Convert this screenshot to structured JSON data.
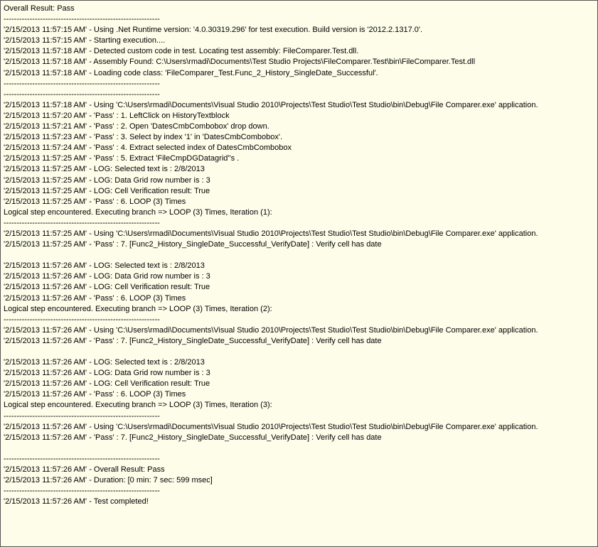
{
  "log": {
    "lines": [
      "Overall Result: Pass",
      "------------------------------------------------------------",
      "'2/15/2013 11:57:15 AM' - Using .Net Runtime version: '4.0.30319.296' for test execution. Build version is '2012.2.1317.0'.",
      "'2/15/2013 11:57:15 AM' - Starting execution....",
      "'2/15/2013 11:57:18 AM' - Detected custom code in test. Locating test assembly: FileComparer.Test.dll.",
      "'2/15/2013 11:57:18 AM' - Assembly Found: C:\\Users\\rmadi\\Documents\\Test Studio Projects\\FileComparer.Test\\bin\\FileComparer.Test.dll",
      "'2/15/2013 11:57:18 AM' - Loading code class: 'FileComparer_Test.Func_2_History_SingleDate_Successful'.",
      "------------------------------------------------------------",
      "------------------------------------------------------------",
      "'2/15/2013 11:57:18 AM' - Using 'C:\\Users\\rmadi\\Documents\\Visual Studio 2010\\Projects\\Test Studio\\Test Studio\\bin\\Debug\\File Comparer.exe' application.",
      "'2/15/2013 11:57:20 AM' - 'Pass' : 1. LeftClick on HistoryTextblock",
      "'2/15/2013 11:57:21 AM' - 'Pass' : 2. Open 'DatesCmbCombobox' drop down.",
      "'2/15/2013 11:57:23 AM' - 'Pass' : 3. Select by index '1' in 'DatesCmbCombobox'.",
      "'2/15/2013 11:57:24 AM' - 'Pass' : 4. Extract selected index of DatesCmbCombobox",
      "'2/15/2013 11:57:25 AM' - 'Pass' : 5. Extract 'FileCmpDGDatagrid''s .",
      "'2/15/2013 11:57:25 AM' - LOG: Selected text is : 2/8/2013",
      "'2/15/2013 11:57:25 AM' - LOG: Data Grid row number is : 3",
      "'2/15/2013 11:57:25 AM' - LOG: Cell Verification result: True",
      "'2/15/2013 11:57:25 AM' - 'Pass' : 6. LOOP (3) Times",
      "Logical step encountered. Executing branch => LOOP (3) Times, Iteration (1):",
      "------------------------------------------------------------",
      "'2/15/2013 11:57:25 AM' - Using 'C:\\Users\\rmadi\\Documents\\Visual Studio 2010\\Projects\\Test Studio\\Test Studio\\bin\\Debug\\File Comparer.exe' application.",
      "'2/15/2013 11:57:25 AM' - 'Pass' : 7. [Func2_History_SingleDate_Successful_VerifyDate] : Verify cell has date",
      "",
      "'2/15/2013 11:57:26 AM' - LOG: Selected text is : 2/8/2013",
      "'2/15/2013 11:57:26 AM' - LOG: Data Grid row number is : 3",
      "'2/15/2013 11:57:26 AM' - LOG: Cell Verification result: True",
      "'2/15/2013 11:57:26 AM' - 'Pass' : 6. LOOP (3) Times",
      "Logical step encountered. Executing branch => LOOP (3) Times, Iteration (2):",
      "------------------------------------------------------------",
      "'2/15/2013 11:57:26 AM' - Using 'C:\\Users\\rmadi\\Documents\\Visual Studio 2010\\Projects\\Test Studio\\Test Studio\\bin\\Debug\\File Comparer.exe' application.",
      "'2/15/2013 11:57:26 AM' - 'Pass' : 7. [Func2_History_SingleDate_Successful_VerifyDate] : Verify cell has date",
      "",
      "'2/15/2013 11:57:26 AM' - LOG: Selected text is : 2/8/2013",
      "'2/15/2013 11:57:26 AM' - LOG: Data Grid row number is : 3",
      "'2/15/2013 11:57:26 AM' - LOG: Cell Verification result: True",
      "'2/15/2013 11:57:26 AM' - 'Pass' : 6. LOOP (3) Times",
      "Logical step encountered. Executing branch => LOOP (3) Times, Iteration (3):",
      "------------------------------------------------------------",
      "'2/15/2013 11:57:26 AM' - Using 'C:\\Users\\rmadi\\Documents\\Visual Studio 2010\\Projects\\Test Studio\\Test Studio\\bin\\Debug\\File Comparer.exe' application.",
      "'2/15/2013 11:57:26 AM' - 'Pass' : 7. [Func2_History_SingleDate_Successful_VerifyDate] : Verify cell has date",
      "",
      "------------------------------------------------------------",
      "'2/15/2013 11:57:26 AM' - Overall Result: Pass",
      "'2/15/2013 11:57:26 AM' - Duration: [0 min: 7 sec: 599 msec]",
      "------------------------------------------------------------",
      "'2/15/2013 11:57:26 AM' - Test completed!"
    ]
  }
}
